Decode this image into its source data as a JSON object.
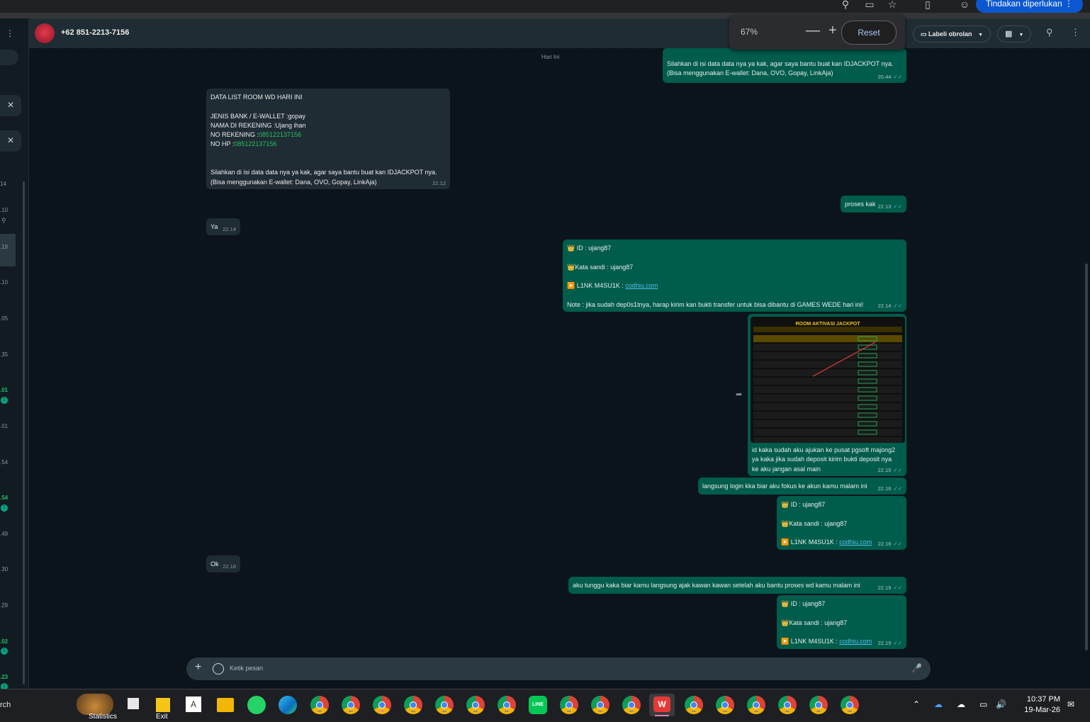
{
  "browser": {
    "action_button": "Tindakan diperlukan"
  },
  "zoom": {
    "value": "67%",
    "minus": "—",
    "plus": "+",
    "reset": "Reset"
  },
  "header": {
    "contact": "+62 851-2213-7156",
    "label_button": "Labeli obrolan"
  },
  "sidebar": {
    "times": [
      "14",
      ".10",
      ".19",
      ".10",
      ".05",
      ".35",
      ".01",
      ".01",
      ".54",
      ".54",
      ".49",
      ".30",
      ".29",
      ".02",
      ".23"
    ],
    "unread": [
      "1",
      "1",
      "1",
      "1"
    ]
  },
  "chat": {
    "day_label": "Hari Ini",
    "messages": {
      "m0": {
        "lines": [
          "Silahkan di isi data data nya ya kak, agar saya bantu buat kan IDJACKPOT nya.",
          "(Bisa menggunakan E-wallet: Dana, OVO, Gopay, LinkAja)"
        ],
        "time": "20.44"
      },
      "m1": {
        "title": "DATA LIST ROOM WD HARI INI",
        "bank_label": "JENIS BANK / E-WALLET :",
        "bank_value": "gopay",
        "name_label": "NAMA DI REKENING :",
        "name_value": "Ujang ihan",
        "rek_label": "NO REKENING :",
        "rek_value": "085122137156",
        "hp_label": "NO HP :",
        "hp_value": "085122137156",
        "line1": "Silahkan di isi data data nya ya kak, agar saya bantu buat kan IDJACKPOT nya.",
        "line2": "(Bisa menggunakan E-wallet: Dana, OVO, Gopay, LinkAja)",
        "time": "22.12"
      },
      "m2": {
        "text": "proses kak",
        "time": "22.13"
      },
      "m3": {
        "text": "Ya",
        "time": "22.14"
      },
      "m4": {
        "id": "👑 ID :  ujang87",
        "pass": "👑Kata sandi : ujang87",
        "link_label": "▶️ L1NK M4SU1K : ",
        "link": "codhiu.com",
        "note": "Note : jika sudah dep0s1tnya, harap kirim kan bukti transfer untuk bisa dibantu di GAMES WEDE hari ini!",
        "time": "22.14"
      },
      "m5": {
        "image_title": "ROOM AKTIVASI JACKPOT",
        "lines": [
          "id kaka sudah aku ajukan ke pusat pgsoft majong2",
          "ya kaka jika sudah deposit kirim bukti deposit nya",
          "ke aku jangan asal main"
        ],
        "time": "22.15"
      },
      "m6": {
        "text": "langsung login kka biar aku fokus ke akun kamu malam ini",
        "time": "22.16"
      },
      "m7": {
        "id": "👑 ID :  ujang87",
        "pass": "👑Kata sandi : ujang87",
        "link_label": "▶️ L1NK M4SU1K : ",
        "link": "codhiu.com",
        "time": "22.16"
      },
      "m8": {
        "text": "Ok",
        "time": "22.18"
      },
      "m9": {
        "text": "aku tunggu kaka biar kamu langsung ajak kawan kawan setelah aku bantu proses wd kamu malam ini",
        "time": "22.19"
      },
      "m10": {
        "id": "👑 ID :  ujang87",
        "pass": "👑Kata sandi : ujang87",
        "link_label": "▶️ L1NK M4SU1K : ",
        "link": "codhiu.com",
        "time": "22.19"
      }
    }
  },
  "input": {
    "placeholder": "Ketik pesan"
  },
  "taskbar": {
    "search": "rch",
    "statistics": "Statistics",
    "exit": "Exit",
    "time": "10:37 PM",
    "date": "19-Mar-26"
  }
}
